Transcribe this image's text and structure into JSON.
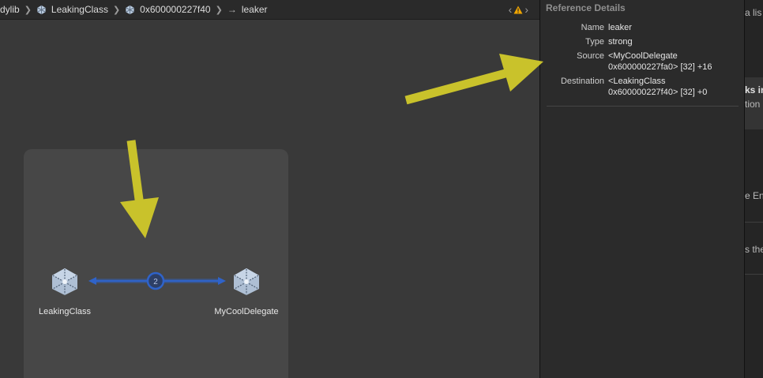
{
  "breadcrumb": {
    "items": [
      {
        "label": "dylib",
        "icon": ""
      },
      {
        "label": "LeakingClass",
        "icon": "object-icon"
      },
      {
        "label": "0x600000227f40",
        "icon": "object-icon"
      },
      {
        "label": "leaker",
        "icon": "arrow-right-icon"
      }
    ]
  },
  "graph": {
    "nodes": [
      {
        "label": "LeakingClass",
        "icon": "object-icon"
      },
      {
        "label": "MyCoolDelegate",
        "icon": "object-icon"
      }
    ],
    "edge_count": "2",
    "edge_color": "#2f63c9"
  },
  "inspector": {
    "title": "Reference Details",
    "rows": [
      {
        "key": "Name",
        "value": [
          "leaker"
        ]
      },
      {
        "key": "Type",
        "value": [
          "strong"
        ]
      },
      {
        "key": "Source",
        "value": [
          "<MyCoolDelegate",
          "0x600000227fa0> [32] +16"
        ]
      },
      {
        "key": "Destination",
        "value": [
          "<LeakingClass",
          "0x600000227f40> [32] +0"
        ]
      }
    ]
  },
  "side_panel": {
    "fragments": [
      "a lis",
      "ks in",
      "tion",
      "e En",
      "s the"
    ]
  },
  "annotation_color": "#c9c22b",
  "warning_color": "#f0a500"
}
